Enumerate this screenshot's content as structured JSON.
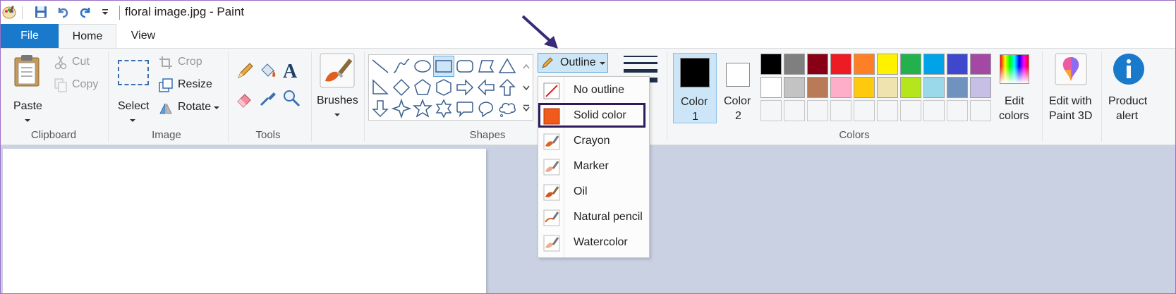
{
  "window": {
    "title": "floral image.jpg - Paint",
    "quick_access": [
      "save-icon",
      "undo-icon",
      "redo-icon",
      "customize-dropdown-icon"
    ]
  },
  "tabs": {
    "file": "File",
    "home": "Home",
    "view": "View"
  },
  "clipboard": {
    "paste": "Paste",
    "cut": "Cut",
    "copy": "Copy",
    "group": "Clipboard"
  },
  "image": {
    "select": "Select",
    "crop": "Crop",
    "resize": "Resize",
    "rotate": "Rotate",
    "group": "Image"
  },
  "tools": {
    "group": "Tools",
    "items": [
      "pencil-icon",
      "fill-icon",
      "text-icon",
      "eraser-icon",
      "color-picker-icon",
      "magnifier-icon"
    ]
  },
  "brushes": {
    "label": "Brushes"
  },
  "shapes": {
    "group": "Shapes",
    "outline_label": "Outline",
    "items": [
      "line",
      "curve",
      "oval",
      "rectangle",
      "rounded-rectangle",
      "polygon",
      "triangle",
      "right-triangle",
      "diamond",
      "pentagon",
      "hexagon",
      "right-arrow",
      "left-arrow",
      "up-arrow",
      "down-arrow",
      "four-point-star",
      "five-point-star",
      "six-point-star",
      "rounded-callout",
      "oval-callout",
      "cloud-callout"
    ]
  },
  "outline_menu": {
    "items": [
      {
        "label": "No outline",
        "icon": "no-outline-icon"
      },
      {
        "label": "Solid color",
        "icon": "solid-color-icon",
        "highlighted": true
      },
      {
        "label": "Crayon",
        "icon": "crayon-icon"
      },
      {
        "label": "Marker",
        "icon": "marker-icon"
      },
      {
        "label": "Oil",
        "icon": "oil-icon"
      },
      {
        "label": "Natural pencil",
        "icon": "natural-pencil-icon"
      },
      {
        "label": "Watercolor",
        "icon": "watercolor-icon"
      }
    ]
  },
  "colors": {
    "group": "Colors",
    "color1": {
      "label1": "Color",
      "label2": "1",
      "value": "#000000"
    },
    "color2": {
      "label1": "Color",
      "label2": "2",
      "value": "#ffffff"
    },
    "palette_row1": [
      "#000000",
      "#7f7f7f",
      "#880015",
      "#ed1c24",
      "#ff7f27",
      "#fff200",
      "#22b14c",
      "#00a2e8",
      "#3f48cc",
      "#a349a4"
    ],
    "palette_row2": [
      "#ffffff",
      "#c3c3c3",
      "#b97a57",
      "#ffaec9",
      "#ffc90e",
      "#efe4b0",
      "#b5e61d",
      "#99d9ea",
      "#7092be",
      "#c8bfe7"
    ],
    "edit_colors": [
      "Edit",
      "colors"
    ]
  },
  "paint3d": {
    "label": [
      "Edit with",
      "Paint 3D"
    ]
  },
  "product_alert": {
    "label": [
      "Product",
      "alert"
    ]
  }
}
